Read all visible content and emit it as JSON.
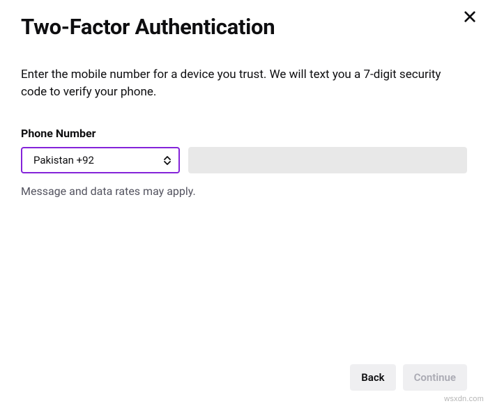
{
  "modal": {
    "title": "Two-Factor Authentication",
    "description": "Enter the mobile number for a device you trust. We will text you a 7-digit security code to verify your phone."
  },
  "phone": {
    "label": "Phone Number",
    "country_selected": "Pakistan +92",
    "input_value": "",
    "helper": "Message and data rates may apply."
  },
  "footer": {
    "back_label": "Back",
    "continue_label": "Continue"
  },
  "watermark": "wsxdn.com"
}
